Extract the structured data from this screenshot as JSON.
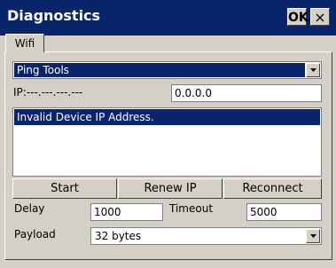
{
  "window": {
    "title": "Diagnostics",
    "ok_label": "OK",
    "close_label": "×"
  },
  "tabs": [
    {
      "label": "Wifi",
      "active": true
    }
  ],
  "tool_select": {
    "value": "Ping Tools"
  },
  "ip": {
    "label": "IP:---.---.---.---",
    "value": "0.0.0.0"
  },
  "output_list": {
    "items": [
      "Invalid Device IP Address."
    ]
  },
  "buttons": {
    "start": "Start",
    "renew_ip": "Renew IP",
    "reconnect": "Reconnect"
  },
  "delay": {
    "label": "Delay",
    "value": "1000"
  },
  "timeout": {
    "label": "Timeout",
    "value": "5000"
  },
  "payload": {
    "label": "Payload",
    "value": "32 bytes"
  },
  "colors": {
    "titlebar": "#0a246a",
    "face": "#d4d0c8",
    "selection": "#0a246a"
  }
}
